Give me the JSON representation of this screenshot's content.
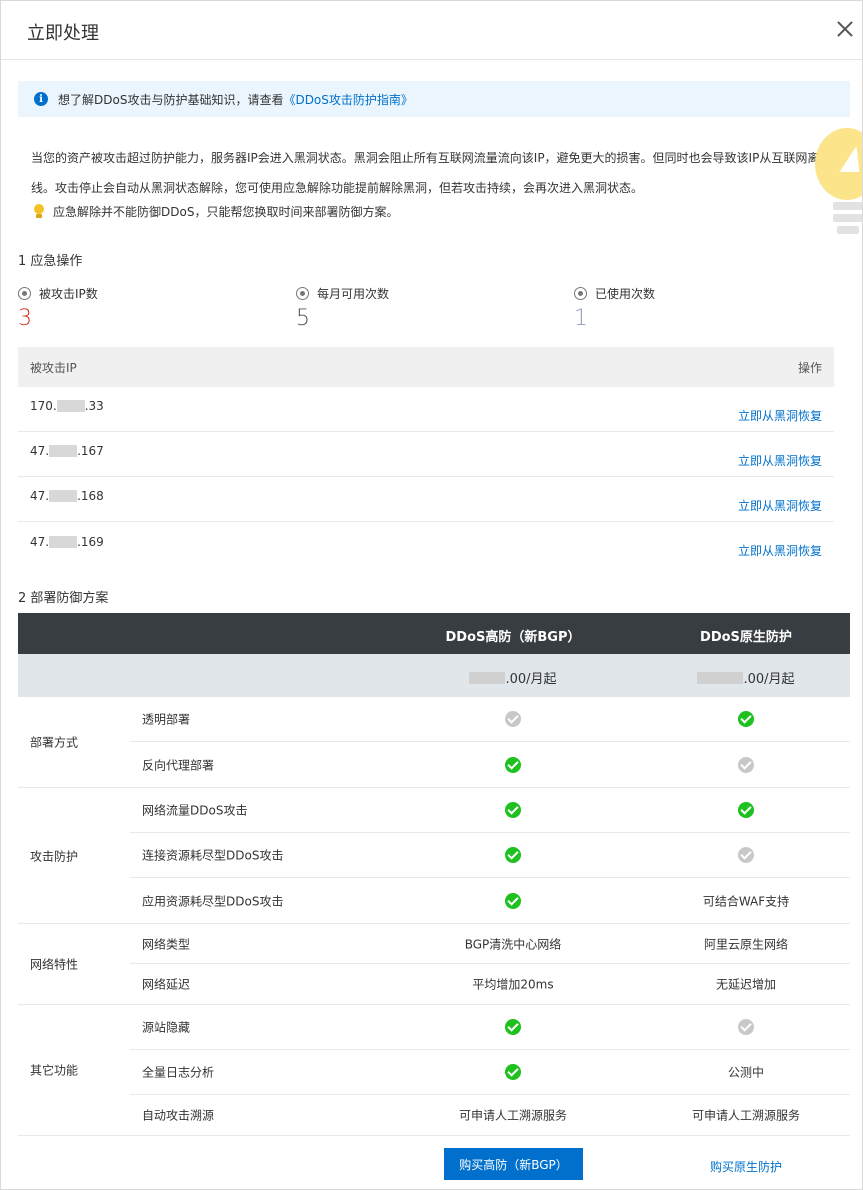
{
  "dialog": {
    "title": "立即处理"
  },
  "notice": {
    "text": "想了解DDoS攻击与防护基础知识，请查看",
    "link": "《DDoS攻击防护指南》"
  },
  "description": {
    "line1": "当您的资产被攻击超过防护能力，服务器IP会进入黑洞状态。黑洞会阻止所有互联网流量流向该IP，避免更大的损害。但同时也会导致该IP从互联网离",
    "line2": "线。攻击停止会自动从黑洞状态解除，您可使用应急解除功能提前解除黑洞，但若攻击持续，会再次进入黑洞状态。"
  },
  "tip": "应急解除并不能防御DDoS，只能帮您换取时间来部署防御方案。",
  "section1": {
    "title": "1 应急操作"
  },
  "stats": [
    {
      "label": "被攻击IP数",
      "value": "3",
      "color": "#d93026"
    },
    {
      "label": "每月可用次数",
      "value": "5",
      "color": "#555555"
    },
    {
      "label": "已使用次数",
      "value": "1",
      "color": "#8a9bb5"
    }
  ],
  "ip_table": {
    "col_ip": "被攻击IP",
    "col_action": "操作",
    "rows": [
      {
        "prefix": "170.",
        "suffix": ".33",
        "action": "立即从黑洞恢复"
      },
      {
        "prefix": "47.",
        "suffix": ".167",
        "action": "立即从黑洞恢复"
      },
      {
        "prefix": "47.",
        "suffix": ".168",
        "action": "立即从黑洞恢复"
      },
      {
        "prefix": "47.",
        "suffix": ".169",
        "action": "立即从黑洞恢复"
      }
    ]
  },
  "section2": {
    "title": "2 部署防御方案"
  },
  "plan": {
    "col_a": "DDoS高防（新BGP）",
    "col_b": "DDoS原生防护",
    "price_a": ".00/月起",
    "price_b": ".00/月起",
    "groups": {
      "deploy": {
        "label": "部署方式",
        "rows": [
          {
            "feature": "透明部署"
          },
          {
            "feature": "反向代理部署"
          }
        ]
      },
      "attack": {
        "label": "攻击防护",
        "rows": [
          {
            "feature": "网络流量DDoS攻击"
          },
          {
            "feature": "连接资源耗尽型DDoS攻击"
          },
          {
            "feature": "应用资源耗尽型DDoS攻击",
            "b": "可结合WAF支持"
          }
        ]
      },
      "network": {
        "label": "网络特性",
        "rows": [
          {
            "feature": "网络类型",
            "a": "BGP清洗中心网络",
            "b": "阿里云原生网络"
          },
          {
            "feature": "网络延迟",
            "a": "平均增加20ms",
            "b": "无延迟增加"
          }
        ]
      },
      "other": {
        "label": "其它功能",
        "rows": [
          {
            "feature": "源站隐藏"
          },
          {
            "feature": "全量日志分析",
            "b": "公测中"
          },
          {
            "feature": "自动攻击溯源",
            "a": "可申请人工溯源服务",
            "b": "可申请人工溯源服务"
          }
        ]
      }
    },
    "buy_a": "购买高防（新BGP）",
    "buy_b": "购买原生防护"
  },
  "colors": {
    "accent": "#0070cc",
    "success": "#1ec11e",
    "header_dark": "#373d41"
  }
}
